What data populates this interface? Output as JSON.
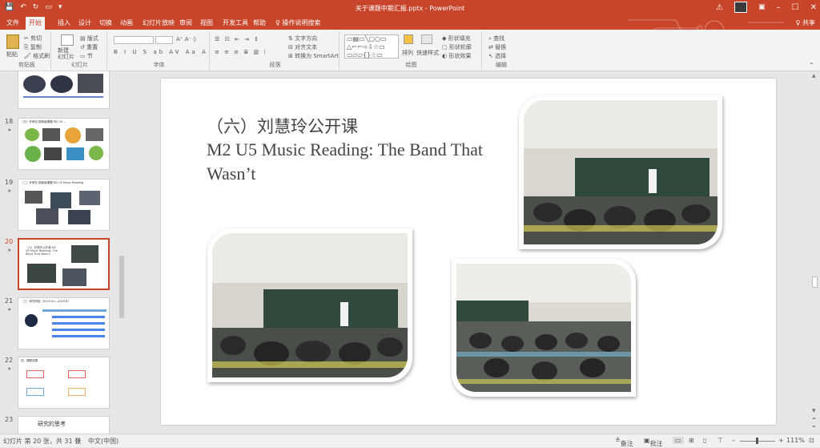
{
  "window": {
    "title": "关于课题中期汇报.pptx - PowerPoint",
    "share_label": "共享"
  },
  "quick_access": [
    "💾",
    "↶",
    "↻",
    "▭",
    "▾"
  ],
  "tabs": [
    "文件",
    "开始",
    "插入",
    "设计",
    "切换",
    "动画",
    "幻灯片放映",
    "审阅",
    "视图",
    "开发工具",
    "帮助",
    "操作说明搜索"
  ],
  "active_tab": "开始",
  "ribbon": {
    "groups": {
      "clipboard": "剪贴板",
      "slides": "幻灯片",
      "font": "字体",
      "paragraph": "段落",
      "drawing": "绘图",
      "editing": "编辑"
    },
    "clipboard": {
      "paste": "粘贴",
      "cut": "剪切",
      "copy": "复制",
      "format_painter": "格式刷"
    },
    "slides": {
      "new_slide": "新建\n幻灯片",
      "layout": "版式",
      "reset": "重置",
      "section": "节"
    },
    "drawing": {
      "arrange": "排列",
      "quick_styles": "快速样式",
      "shape_fill": "形状填充",
      "shape_outline": "形状轮廓",
      "shape_effects": "形状效果"
    },
    "paragraph": {
      "text_direction": "文字方向",
      "align_text": "对齐文本",
      "smartart": "转换为 SmartArt"
    },
    "editing": {
      "find": "查找",
      "replace": "替换",
      "select": "选择"
    }
  },
  "thumbnails": [
    {
      "num": "",
      "title": ""
    },
    {
      "num": "18",
      "title": "（五）外研社·国家级课题 M2 U5 ..."
    },
    {
      "num": "19",
      "title": "（二）外研社·国家级课题 M2 U5 Music Reading"
    },
    {
      "num": "20",
      "title": "（六）刘慧玲公开课 M2 U5 Music Reading: The Band That Wasn't"
    },
    {
      "num": "21",
      "title": "（三）研究阶段（2019.02—2019.6）"
    },
    {
      "num": "22",
      "title": "四、课题成果"
    },
    {
      "num": "23",
      "title": "研究的思考"
    }
  ],
  "selected_slide": "20",
  "slide": {
    "title_cn": "（六）刘慧玲公开课",
    "title_en": "M2 U5 Music Reading: The Band That Wasn’t"
  },
  "status": {
    "slide_info": "幻灯片 第 20 张，共 31 张",
    "language": "中文(中国)",
    "notes": "备注",
    "comments": "批注",
    "zoom": "111%"
  },
  "colors": {
    "brand": "#c8442a",
    "ribbon_bg": "#f3f3f3",
    "workspace_bg": "#e6e6e6"
  }
}
